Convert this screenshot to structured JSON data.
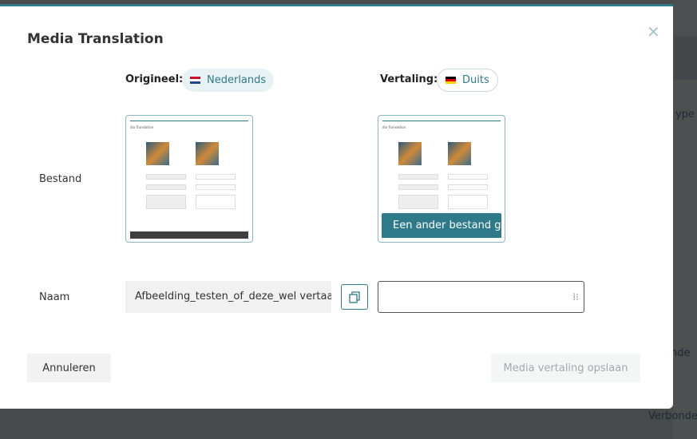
{
  "background": {
    "col_header": "ype",
    "cell1": "onde",
    "cell2": "Verbonde"
  },
  "modal": {
    "title": "Media Translation",
    "original": {
      "label": "Origineel:",
      "language": "Nederlands"
    },
    "translation": {
      "label": "Vertaling:",
      "language": "Duits"
    },
    "rows": {
      "file_label": "Bestand",
      "name_label": "Naam"
    },
    "other_file_button": "Een ander bestand gebruiken",
    "name_original": "Afbeelding_testen_of_deze_wel vertaald",
    "name_translation": "",
    "cancel": "Annuleren",
    "save": "Media vertaling opslaan"
  },
  "thumbnail": {
    "title": "dia Translation"
  }
}
